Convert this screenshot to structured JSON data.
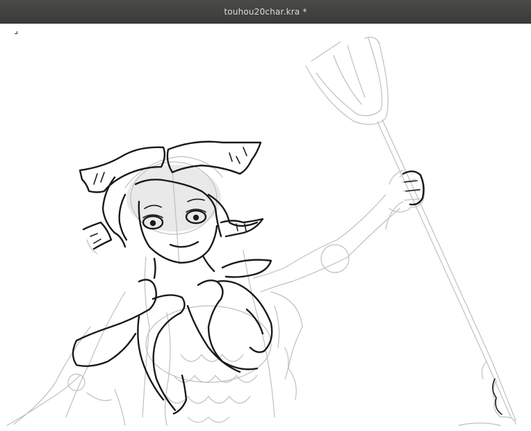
{
  "window": {
    "title": "touhou20char.kra *"
  },
  "canvas": {
    "background": "#ffffff",
    "sketch_color": "#bfbfbf",
    "ink_color": "#1a1a1a"
  },
  "icons": {
    "canvas_corner": "corner-bracket-icon"
  }
}
